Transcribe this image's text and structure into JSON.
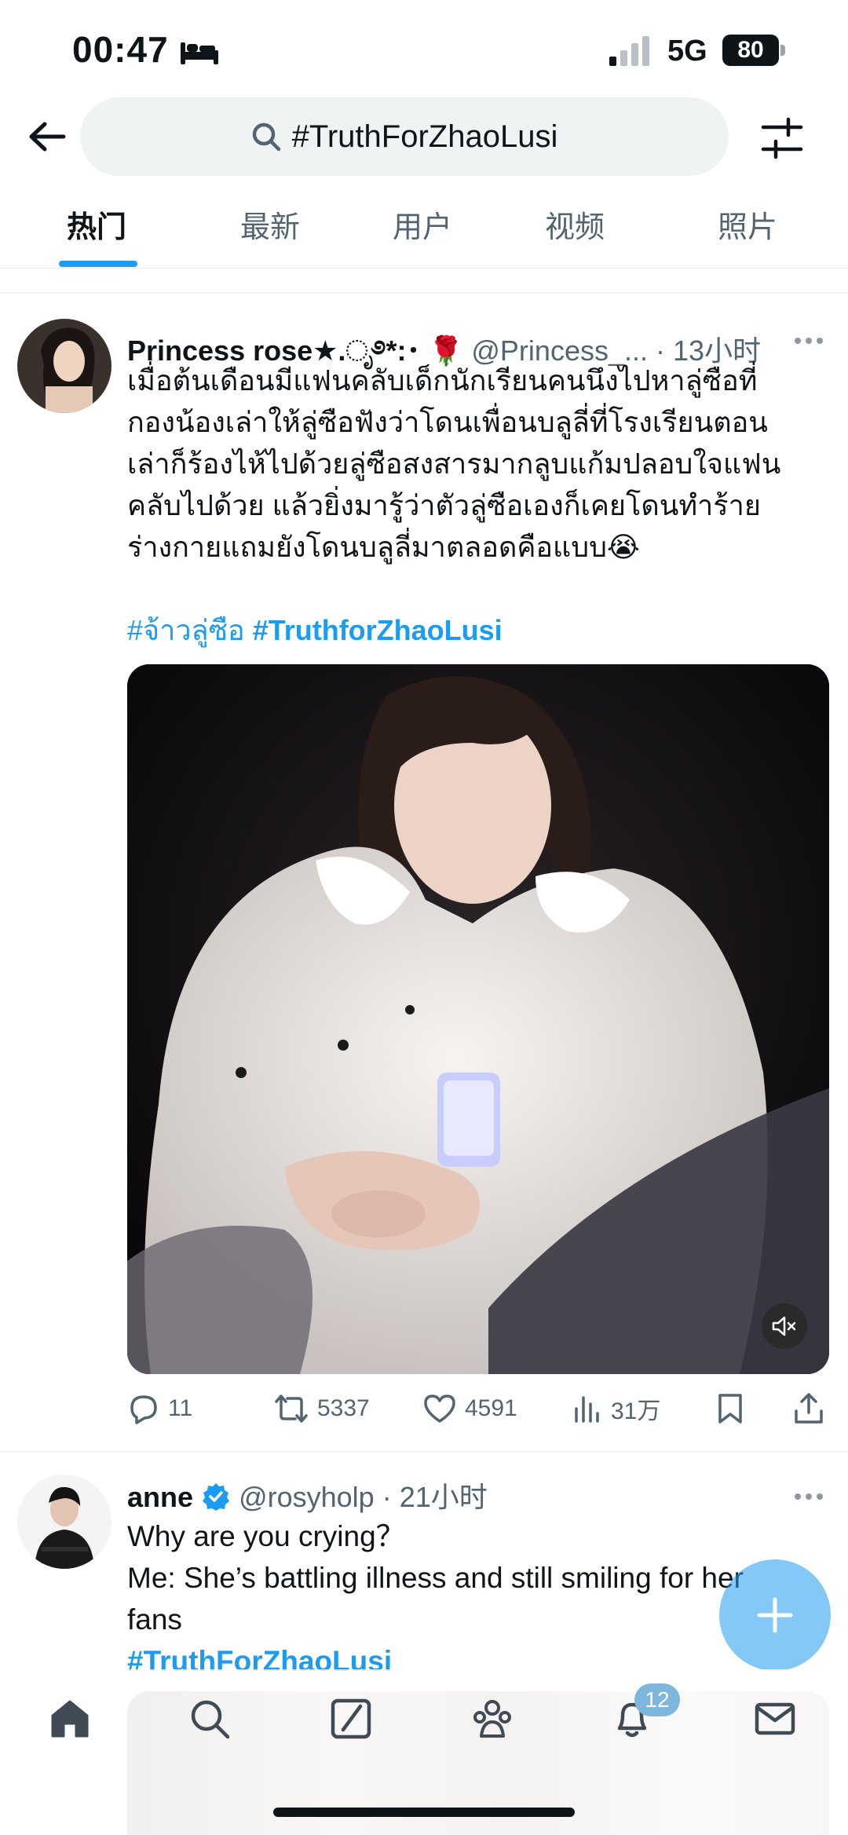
{
  "status": {
    "time": "00:47",
    "network": "5G",
    "battery": "80"
  },
  "search": {
    "query": "#TruthForZhaoLusi"
  },
  "tabs": [
    {
      "label": "热门",
      "active": true
    },
    {
      "label": "最新",
      "active": false
    },
    {
      "label": "用户",
      "active": false
    },
    {
      "label": "视频",
      "active": false
    },
    {
      "label": "照片",
      "active": false
    }
  ],
  "posts": [
    {
      "display_name": "Princess rose★.ೃ࿔*:･",
      "emoji": "🌹",
      "handle": "@Princess_...",
      "time": "· 13小时",
      "text_lines": [
        "เมื่อต้นเดือนมีแฟนคลับเด็กนักเรียนคนนึงไปหาลู่ซือที่",
        "กองน้องเล่าให้ลู่ซือฟังว่าโดนเพื่อนบลูลี่ที่โรงเรียนตอน",
        "เล่าก็ร้องไห้ไปด้วยลู่ซือสงสารมากลูบแก้มปลอบใจแฟน",
        "คลับไปด้วย แล้วยิ่งมารู้ว่าตัวลู่ซือเองก็เคยโดนทำร้าย",
        "ร่างกายแถมยังโดนบลูลี่มาตลอดคือแบบ😭"
      ],
      "hashtag_1": "#จ้าวลู่ซือ",
      "hashtag_2": "#TruthforZhaoLusi",
      "replies": "11",
      "reposts": "5337",
      "likes": "4591",
      "views": "31万"
    },
    {
      "display_name": "anne",
      "handle": "@rosyholp",
      "time": "· 21小时",
      "text_lines": [
        "Why are you crying？",
        "Me: She’s battling illness and still smiling for her",
        "fans"
      ],
      "hashtag": "#TruthForZhaoLusi"
    }
  ],
  "notifications_badge": "12",
  "colors": {
    "accent": "#1d9bf0",
    "text": "#0f1419",
    "secondary": "#536471",
    "verified": "#1d9bf0"
  }
}
